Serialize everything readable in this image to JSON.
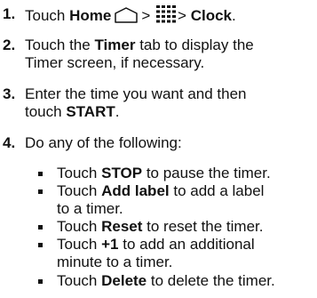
{
  "steps": [
    {
      "number": "1.",
      "parts": {
        "touch": "Touch",
        "home": "Home",
        "sep1": ">",
        "sep2": ">",
        "clock": "Clock",
        "period": "."
      },
      "icons": [
        "home-icon",
        "apps-grid-icon"
      ]
    },
    {
      "number": "2.",
      "parts": {
        "touch": "Touch the",
        "timer": "Timer",
        "rest1": "tab to display the",
        "rest2": "Timer screen, if necessary."
      }
    },
    {
      "number": "3.",
      "parts": {
        "line1": "Enter the time you want and then",
        "touch": "touch",
        "start": "START",
        "period": "."
      }
    },
    {
      "number": "4.",
      "parts": {
        "text": "Do any of the following:"
      }
    }
  ],
  "bullets": [
    {
      "pre": "Touch",
      "bold": "STOP",
      "post": "to pause the timer."
    },
    {
      "pre": "Touch",
      "bold": "Add label",
      "post": "to add a label",
      "line2": "to a timer."
    },
    {
      "pre": "Touch",
      "bold": "Reset",
      "post": "to reset the timer."
    },
    {
      "pre": "Touch",
      "bold": "+1",
      "post": "to add an additional",
      "line2": "minute to a timer."
    },
    {
      "pre": "Touch",
      "bold": "Delete",
      "post": "to delete the timer."
    }
  ],
  "colors": {
    "text": "#111111",
    "background": "#ffffff"
  }
}
